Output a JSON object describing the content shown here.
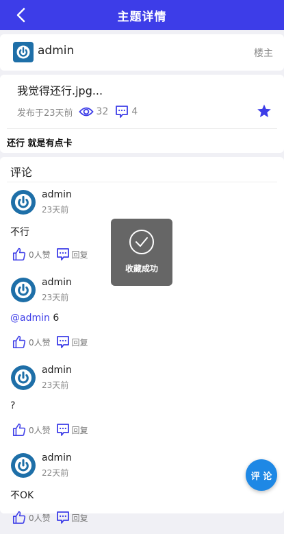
{
  "header": {
    "title": "主题详情",
    "back_icon": "back-arrow-icon"
  },
  "author": {
    "name": "admin",
    "role_label": "楼主",
    "logo_icon": "power-logo-icon"
  },
  "topic": {
    "title": "我觉得还行.jpg...",
    "posted": "发布于23天前",
    "views": "32",
    "comments": "4",
    "favorited": true,
    "body": "还行 就是有点卡"
  },
  "comments_section": {
    "header": "评论",
    "items": [
      {
        "user": "admin",
        "time": "23天前",
        "mention": "",
        "text": "不行",
        "likes": "0人赞",
        "reply": "回复"
      },
      {
        "user": "admin",
        "time": "23天前",
        "mention": "@admin",
        "text": " 6",
        "likes": "0人赞",
        "reply": "回复"
      },
      {
        "user": "admin",
        "time": "23天前",
        "mention": "",
        "text": "?",
        "likes": "0人赞",
        "reply": "回复"
      },
      {
        "user": "admin",
        "time": "22天前",
        "mention": "",
        "text": "不OK",
        "likes": "0人赞",
        "reply": "回复"
      }
    ]
  },
  "toast": {
    "message": "收藏成功",
    "icon": "check-icon"
  },
  "fab": {
    "label": "评 论"
  },
  "colors": {
    "primary": "#3d3de8",
    "avatar": "#1e6fa8",
    "fab": "#1e88e5"
  }
}
